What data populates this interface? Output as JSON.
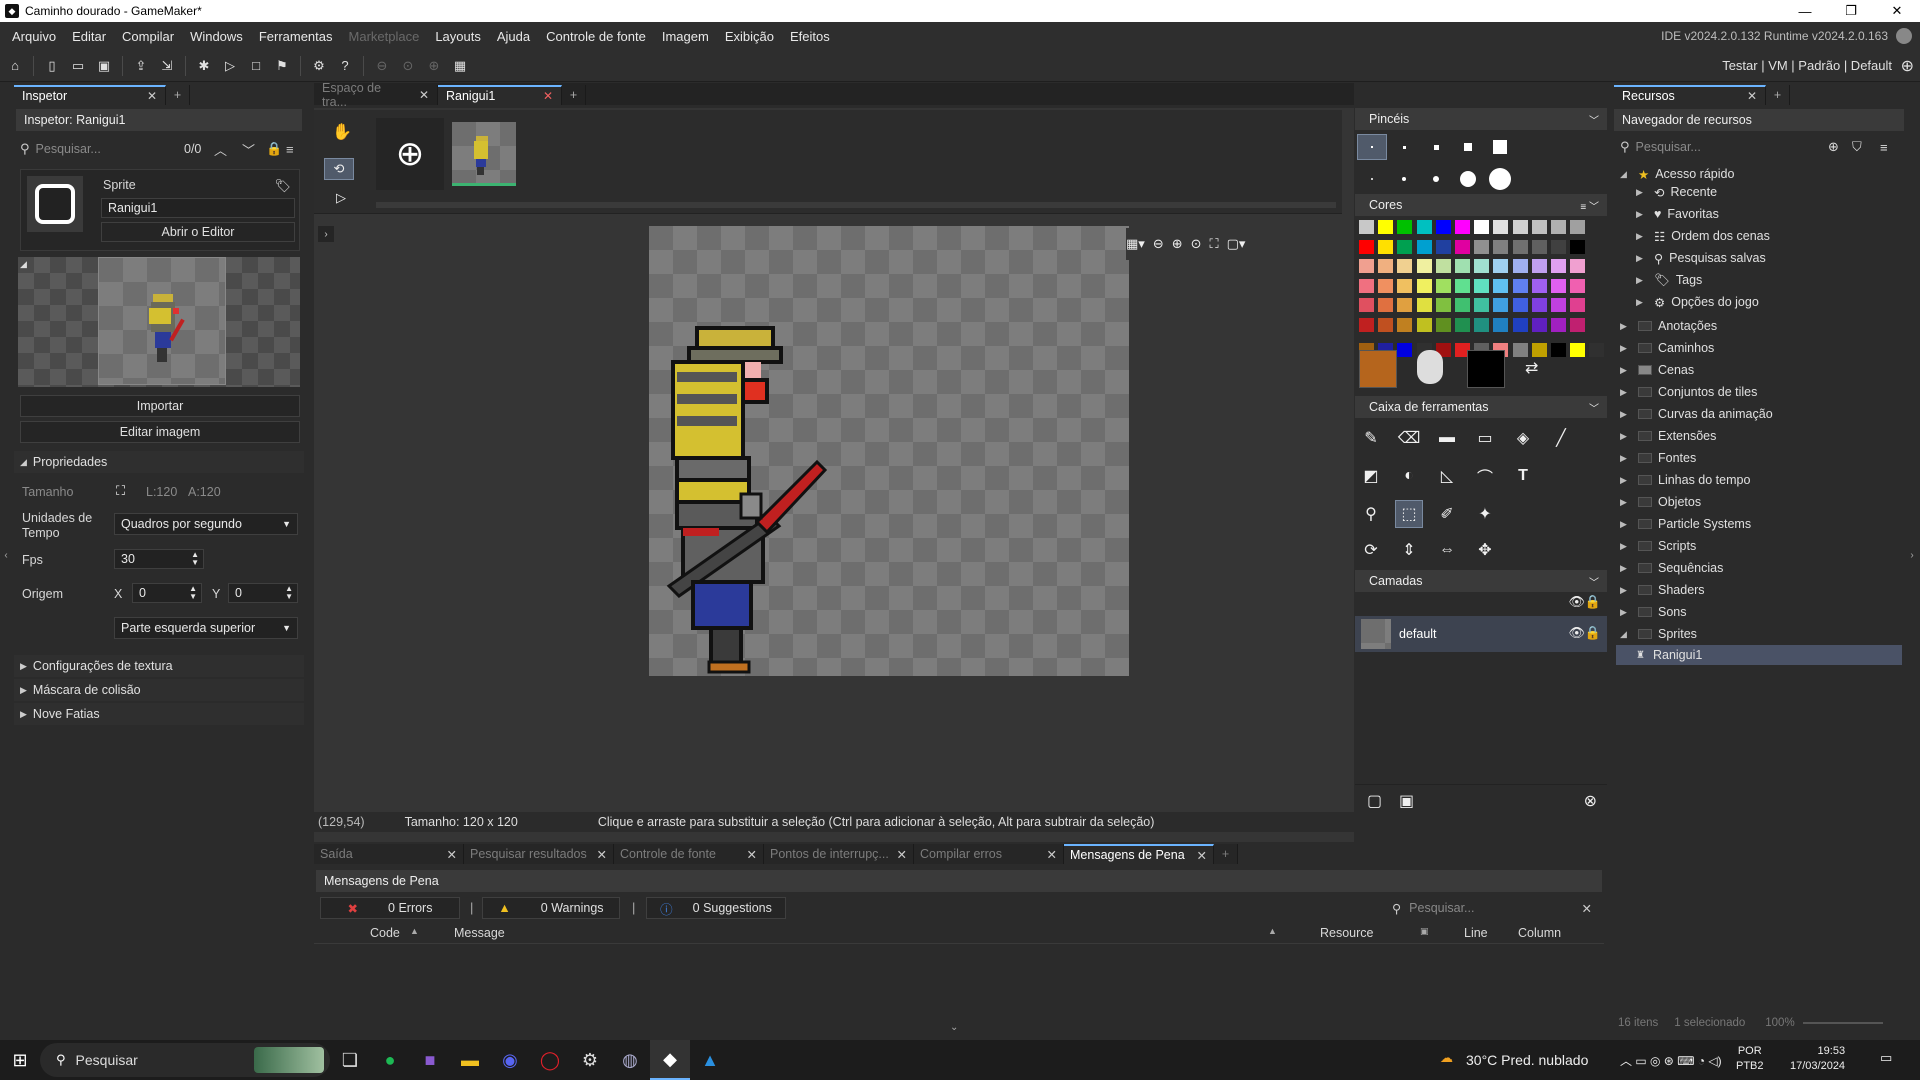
{
  "window": {
    "title": "Caminho dourado - GameMaker*",
    "min": "—",
    "max": "❐",
    "close": "✕"
  },
  "menu": {
    "items": [
      "Arquivo",
      "Editar",
      "Compilar",
      "Windows",
      "Ferramentas",
      "Marketplace",
      "Layouts",
      "Ajuda",
      "Controle de fonte",
      "Imagem",
      "Exibição",
      "Efeitos"
    ],
    "version": "IDE v2024.2.0.132  Runtime v2024.2.0.163"
  },
  "toolbar": {
    "target": "Testar | VM | Padrão | Default"
  },
  "inspector": {
    "tab": "Inspetor",
    "header": "Inspetor: Ranigui1",
    "search_placeholder": "Pesquisar...",
    "count": "0/0",
    "sprite_label": "Sprite",
    "sprite_name": "Ranigui1",
    "open_editor": "Abrir o Editor",
    "import": "Importar",
    "edit_image": "Editar imagem",
    "properties": "Propriedades",
    "size_label": "Tamanho",
    "size_w": "L:120",
    "size_h": "A:120",
    "time_units_label": "Unidades de Tempo",
    "time_units_value": "Quadros por segundo",
    "fps_label": "Fps",
    "fps_value": "30",
    "origin_label": "Origem",
    "origin_x_label": "X",
    "origin_x": "0",
    "origin_y_label": "Y",
    "origin_y": "0",
    "origin_preset": "Parte esquerda superior",
    "texture_settings": "Configurações de textura",
    "collision_mask": "Máscara de colisão",
    "nine_slice": "Nove Fatias"
  },
  "editor": {
    "tabs": [
      {
        "label": "Espaço de tra...",
        "active": false
      },
      {
        "label": "Ranigui1",
        "active": true
      }
    ],
    "status_coords": "(129,54)",
    "status_size": "Tamanho: 120 x 120",
    "status_hint": "Clique e arraste para substituir a seleção (Ctrl para adicionar à seleção, Alt para subtrair da seleção)"
  },
  "brushes": {
    "title": "Pincéis"
  },
  "colors": {
    "title": "Cores",
    "palette": [
      [
        "#c8c8c8",
        "#ffff00",
        "#00c000",
        "#00c0c0",
        "#0000ff",
        "#ff00ff",
        "#ffffff",
        "#e0e0e0",
        "#d0d0d0",
        "#c0c0c0",
        "#b0b0b0",
        "#a0a0a0"
      ],
      [
        "#ff0000",
        "#ffe000",
        "#00a050",
        "#00a0d0",
        "#2040a0",
        "#e000a0",
        "#909090",
        "#808080",
        "#707070",
        "#606060",
        "#404040",
        "#000000"
      ],
      [
        "#f0a090",
        "#f0b080",
        "#f0d090",
        "#f0f0a0",
        "#c0e0a0",
        "#a0e0b0",
        "#a0e0d0",
        "#a0d0f0",
        "#a0b0f0",
        "#c0a0f0",
        "#e0a0f0",
        "#f0a0d0"
      ],
      [
        "#f07080",
        "#f09060",
        "#f0c060",
        "#f0f060",
        "#a0e060",
        "#60e090",
        "#60e0c0",
        "#60c0f0",
        "#6080f0",
        "#a060f0",
        "#e060f0",
        "#f060b0"
      ],
      [
        "#e05060",
        "#e07040",
        "#e0a040",
        "#e0e040",
        "#80c040",
        "#40c070",
        "#40c0a0",
        "#40a0e0",
        "#4060e0",
        "#8040e0",
        "#c040e0",
        "#e04090"
      ],
      [
        "#c02020",
        "#c05020",
        "#c08020",
        "#c0c020",
        "#609020",
        "#209050",
        "#209080",
        "#2080c0",
        "#2040c0",
        "#6020c0",
        "#a020c0",
        "#c02070"
      ],
      [
        "#a06010",
        "#2020a0",
        "#0000e0",
        "#303030",
        "#a01010",
        "#e02020",
        "#606060",
        "#f08080",
        "#808080",
        "#c0a000",
        "#000000",
        "#ffff00",
        "#303030"
      ]
    ],
    "primary": "#b5651d",
    "secondary": "#000000"
  },
  "toolbox": {
    "title": "Caixa de ferramentas"
  },
  "layers": {
    "title": "Camadas",
    "items": [
      {
        "name": "default"
      }
    ]
  },
  "resources": {
    "tab": "Recursos",
    "header": "Navegador de recursos",
    "search_placeholder": "Pesquisar...",
    "quick": "Acesso rápido",
    "quick_items": [
      "Recente",
      "Favoritas",
      "Ordem dos cenas",
      "Pesquisas salvas",
      "Tags",
      "Opções do jogo"
    ],
    "folders": [
      "Anotações",
      "Caminhos",
      "Cenas",
      "Conjuntos de tiles",
      "Curvas da animação",
      "Extensões",
      "Fontes",
      "Linhas do tempo",
      "Objetos",
      "Particle Systems",
      "Scripts",
      "Sequências",
      "Shaders",
      "Sons",
      "Sprites"
    ],
    "selected": "Ranigui1",
    "footer_items": "16 itens",
    "footer_selected": "1 selecionado",
    "zoom": "100%"
  },
  "output": {
    "tabs": [
      "Saída",
      "Pesquisar resultados",
      "Controle de fonte",
      "Pontos de interrupç...",
      "Compilar erros",
      "Mensagens de Pena"
    ],
    "title": "Mensagens de Pena",
    "errors": "0 Errors",
    "warnings": "0 Warnings",
    "suggestions": "0 Suggestions",
    "search_placeholder": "Pesquisar...",
    "columns": [
      "Code",
      "Message",
      "Resource",
      "Line",
      "Column"
    ]
  },
  "taskbar": {
    "search": "Pesquisar",
    "weather": "30°C  Pred. nublado",
    "lang1": "POR",
    "lang2": "PTB2",
    "time": "19:53",
    "date": "17/03/2024"
  }
}
